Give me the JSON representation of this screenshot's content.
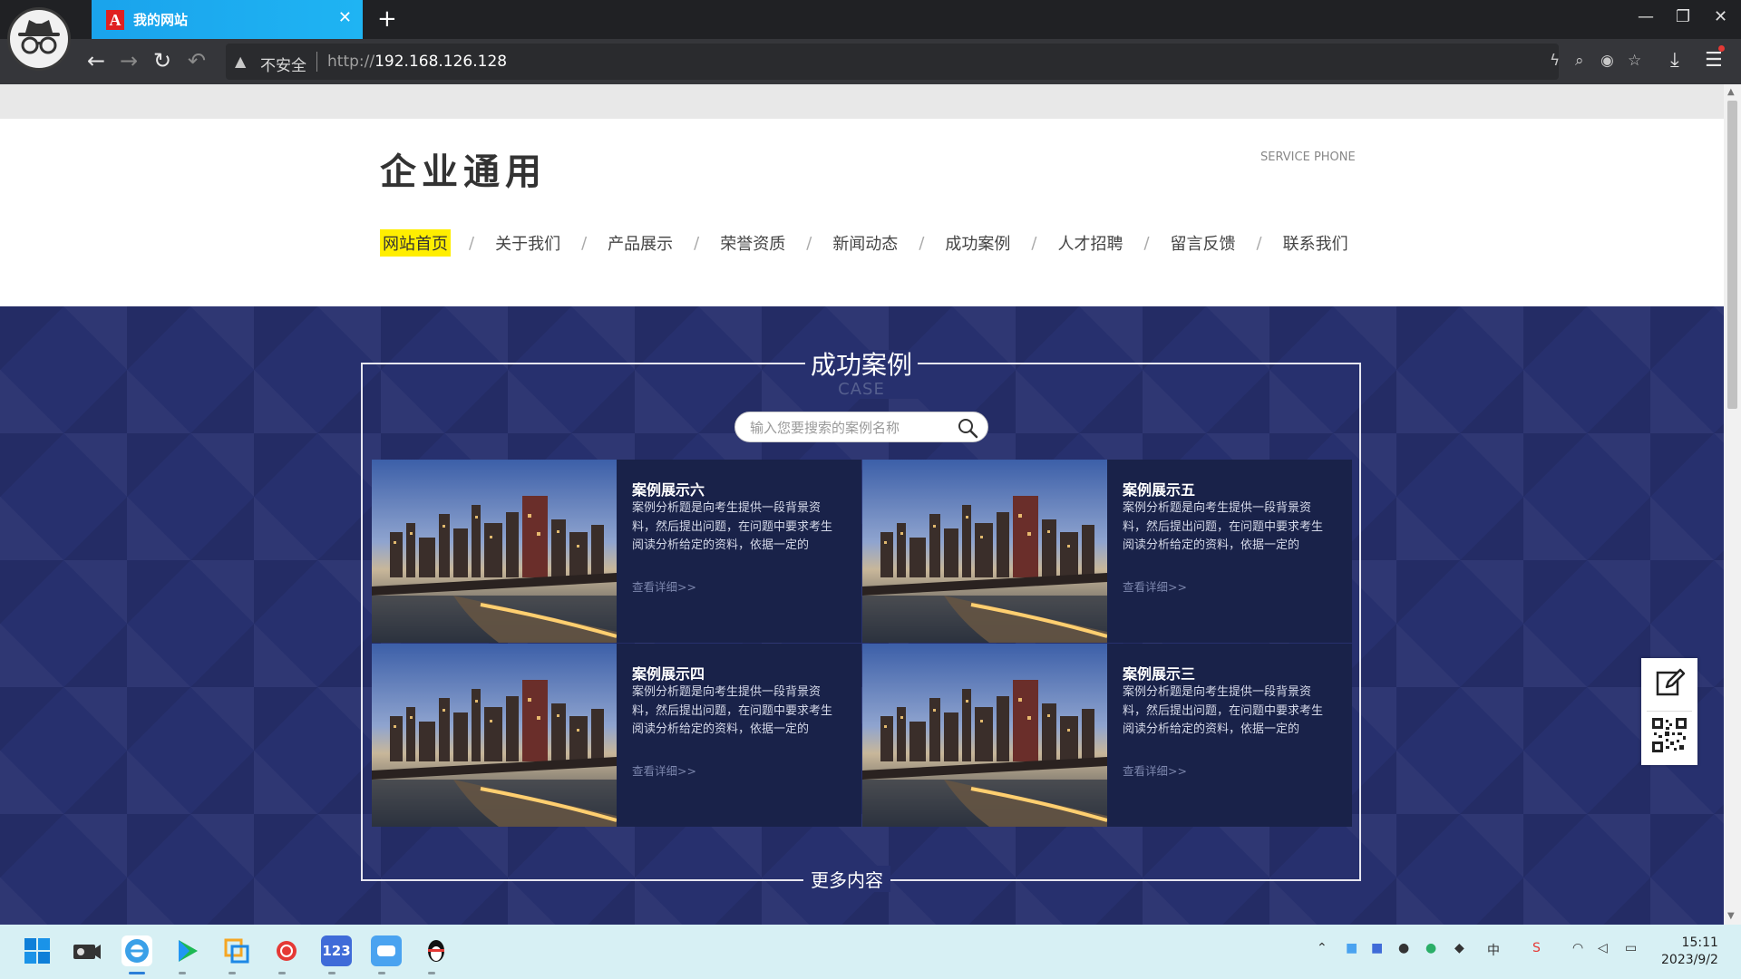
{
  "browser": {
    "tab_title": "我的网站",
    "tab_favicon": "A",
    "security_label": "不安全",
    "url_scheme": "http://",
    "url_host": "192.168.126.128"
  },
  "site": {
    "logo": "企业通用",
    "service_phone_label": "SERVICE PHONE",
    "nav": [
      {
        "label": "网站首页",
        "active": true
      },
      {
        "label": "关于我们"
      },
      {
        "label": "产品展示"
      },
      {
        "label": "荣誉资质"
      },
      {
        "label": "新闻动态"
      },
      {
        "label": "成功案例"
      },
      {
        "label": "人才招聘"
      },
      {
        "label": "留言反馈"
      },
      {
        "label": "联系我们"
      }
    ]
  },
  "cases": {
    "title": "成功案例",
    "subtitle": "CASE",
    "search_placeholder": "输入您要搜索的案例名称",
    "items": [
      {
        "title": "案例展示六",
        "desc": "案例分析题是向考生提供一段背景资料，然后提出问题，在问题中要求考生阅读分析给定的资料，依据一定的",
        "more": "查看详细>>"
      },
      {
        "title": "案例展示五",
        "desc": "案例分析题是向考生提供一段背景资料，然后提出问题，在问题中要求考生阅读分析给定的资料，依据一定的",
        "more": "查看详细>>"
      },
      {
        "title": "案例展示四",
        "desc": "案例分析题是向考生提供一段背景资料，然后提出问题，在问题中要求考生阅读分析给定的资料，依据一定的",
        "more": "查看详细>>"
      },
      {
        "title": "案例展示三",
        "desc": "案例分析题是向考生提供一段背景资料，然后提出问题，在问题中要求考生阅读分析给定的资料，依据一定的",
        "more": "查看详细>>"
      }
    ],
    "more_label": "更多内容"
  },
  "taskbar": {
    "time": "15:11",
    "date": "2023/9/2",
    "ime_label": "中",
    "app_123_label": "123"
  },
  "colors": {
    "nav_active": "#ffee00",
    "case_bg": "#27306e",
    "card_bg": "#192249",
    "tab_accent": "#1aa3ec"
  }
}
